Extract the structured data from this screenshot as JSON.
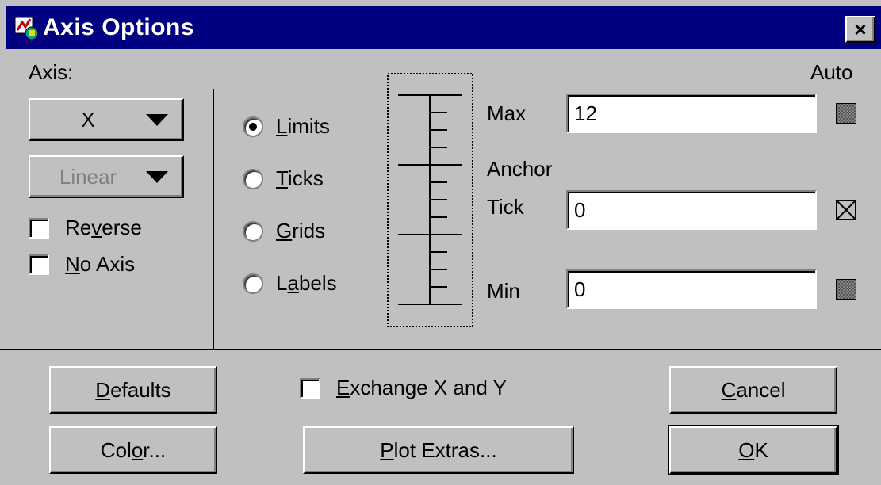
{
  "window": {
    "title": "Axis Options",
    "close_label": "×"
  },
  "axis": {
    "label": "Axis:",
    "axis_select": "X",
    "scale_select": "Linear",
    "reverse": {
      "pre": "Re",
      "ul": "v",
      "post": "erse",
      "checked": false
    },
    "no_axis": {
      "pre": "",
      "ul": "N",
      "post": "o Axis",
      "checked": false
    }
  },
  "modes": [
    {
      "pre": "",
      "ul": "L",
      "post": "imits",
      "selected": true
    },
    {
      "pre": "",
      "ul": "T",
      "post": "icks",
      "selected": false
    },
    {
      "pre": "",
      "ul": "G",
      "post": "rids",
      "selected": false
    },
    {
      "pre": "L",
      "ul": "a",
      "post": "bels",
      "selected": false
    }
  ],
  "limits": {
    "auto_label": "Auto",
    "max_label": "Max",
    "max_value": "12",
    "anchor_label": "Anchor",
    "tick_label": "Tick",
    "tick_value": "0",
    "min_label": "Min",
    "min_value": "0"
  },
  "bottom": {
    "defaults": {
      "pre": "",
      "ul": "D",
      "post": "efaults"
    },
    "color": {
      "pre": "Col",
      "ul": "o",
      "post": "r..."
    },
    "exchange": {
      "pre": "",
      "ul": "E",
      "post": "xchange X and Y",
      "checked": false
    },
    "plot_extras": {
      "pre": "",
      "ul": "P",
      "post": "lot Extras..."
    },
    "cancel": {
      "pre": "",
      "ul": "C",
      "post": "ancel"
    },
    "ok": {
      "pre": "",
      "ul": "O",
      "post": "K"
    }
  },
  "colors": {
    "titlebar": "#000080",
    "face": "#c0c0c0"
  }
}
